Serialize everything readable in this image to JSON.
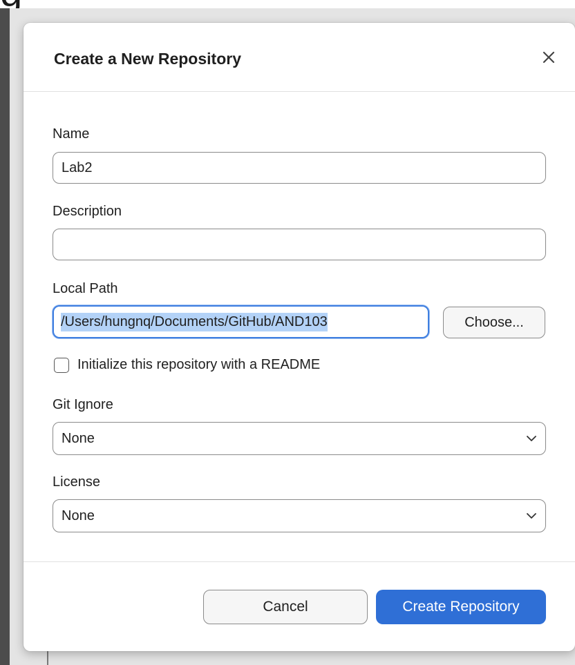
{
  "background": {
    "clipped_heading": "g"
  },
  "dialog": {
    "title": "Create a New Repository",
    "close_icon": "close-icon"
  },
  "form": {
    "name": {
      "label": "Name",
      "value": "Lab2",
      "placeholder": ""
    },
    "description": {
      "label": "Description",
      "value": "",
      "placeholder": ""
    },
    "local_path": {
      "label": "Local Path",
      "value": "/Users/hungnq/Documents/GitHub/AND103",
      "choose_label": "Choose..."
    },
    "readme": {
      "label": "Initialize this repository with a README",
      "checked": false
    },
    "git_ignore": {
      "label": "Git Ignore",
      "selected": "None",
      "icon": "chevron-down-icon"
    },
    "license": {
      "label": "License",
      "selected": "None",
      "icon": "chevron-down-icon"
    }
  },
  "footer": {
    "cancel_label": "Cancel",
    "create_label": "Create Repository"
  },
  "colors": {
    "accent": "#2f6fd6",
    "selection": "#b3d2f7",
    "focus_ring": "#3f7fe0"
  }
}
